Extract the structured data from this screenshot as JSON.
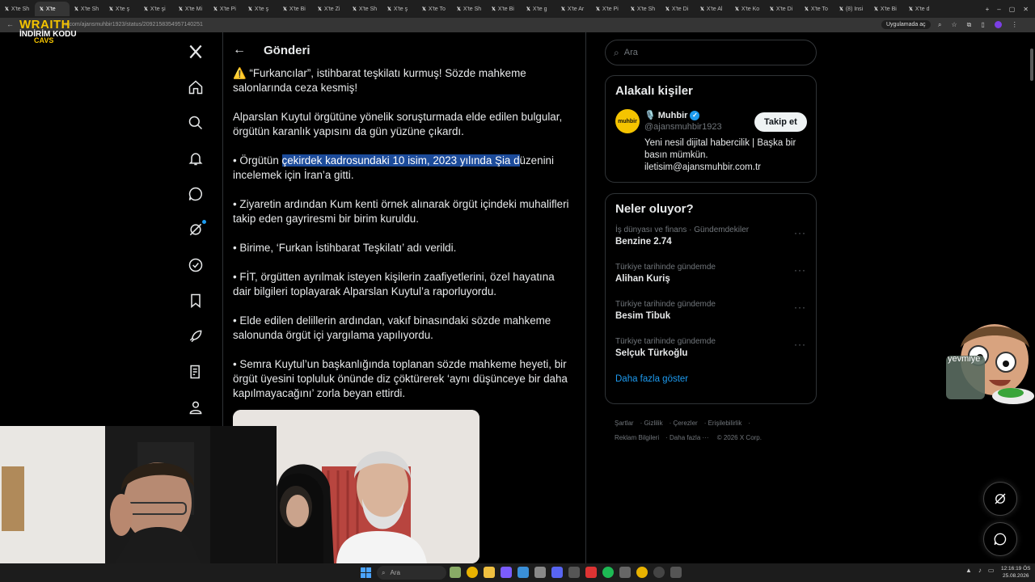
{
  "browser": {
    "tabs": [
      "X'te Sh",
      "X'te",
      "X'te Sh",
      "X'te ş",
      "X'te şi",
      "X'te Mi",
      "X'te Pi",
      "X'te ş",
      "X'te Bi",
      "X'te Zi",
      "X'te Sh",
      "X'te ş",
      "X'te To",
      "X'te Sh",
      "X'te Bi",
      "X'te g",
      "X'te Ar",
      "X'te Pi",
      "X'te Sh",
      "X'te Di",
      "X'te Al",
      "X'te Ko",
      "X'te Di",
      "X'te To",
      "(8) Insi",
      "X'te Bi",
      "X'te d"
    ],
    "active_tab": "X'te",
    "url": "x.com/ajansmuhbir1923/status/2092158354957140251",
    "app_button": "Uygulamada aç"
  },
  "stream_logo": {
    "line1": "WRAITH",
    "line2": "İNDİRİM KODU",
    "line3": "CAVS"
  },
  "nav_icons": [
    "x-logo-icon",
    "home-icon",
    "search-icon",
    "notifications-icon",
    "messages-icon",
    "grok-icon",
    "verified-icon",
    "bookmarks-icon",
    "rocket-icon",
    "premium-icon",
    "profile-icon"
  ],
  "header": {
    "title": "Gönderi"
  },
  "post": {
    "p1": "⚠️ “Furkancılar”, istihbarat teşkilatı kurmuş! Sözde mahkeme salonlarında ceza kesmiş!",
    "p2": "Alparslan Kuytul örgütüne yönelik soruşturmada elde edilen bulgular, örgütün karanlık yapısını da gün yüzüne çıkardı.",
    "p3_before": "• Örgütün ",
    "p3_highlight": "çekirdek kadrosundaki 10 isim, 2023 yılında Şia d",
    "p3_after": "üzenini incelemek için İran’a gitti.",
    "p4": "• Ziyaretin ardından Kum kenti örnek alınarak örgüt içindeki muhalifleri takip eden gayriresmi bir birim kuruldu.",
    "p5": "• Birime, ‘Furkan İstihbarat Teşkilatı’ adı verildi.",
    "p6": "• FİT, örgütten ayrılmak isteyen kişilerin zaafiyetlerini, özel hayatına dair bilgileri toplayarak Alparslan Kuytul’a raporluyordu.",
    "p7": "• Elde edilen delillerin ardından, vakıf binasındaki sözde mahkeme salonunda örgüt içi yargılama yapılıyordu.",
    "p8": "• Semra Kuytul’un başkanlığında toplanan sözde mahkeme heyeti, bir örgüt üyesini topluluk önünde diz çöktürerek ‘aynı düşünceye bir daha kapılmayacağını’ zorla beyan ettirdi."
  },
  "search": {
    "placeholder": "Ara"
  },
  "related": {
    "title": "Alakalı kişiler",
    "avatar_text": "muhbir",
    "name": "🎙️ Muhbir",
    "handle": "@ajansmuhbir1923",
    "follow_label": "Takip et",
    "bio": "Yeni nesil dijital habercilik | Başka bir basın mümkün. iletisim@ajansmuhbir.com.tr"
  },
  "trends": {
    "title": "Neler oluyor?",
    "items": [
      {
        "category": "İş dünyası ve finans · Gündemdekiler",
        "name": "Benzine 2.74"
      },
      {
        "category": "Türkiye tarihinde gündemde",
        "name": "Alihan Kuriş"
      },
      {
        "category": "Türkiye tarihinde gündemde",
        "name": "Besim Tibuk"
      },
      {
        "category": "Türkiye tarihinde gündemde",
        "name": "Selçuk Türkoğlu"
      }
    ],
    "show_more": "Daha fazla göster"
  },
  "footer": {
    "links": [
      "Şartlar",
      "Gizlilik",
      "Çerezler",
      "Erişilebilirlik",
      "Reklam Bilgileri",
      "Daha fazla ···"
    ],
    "copyright": "© 2026 X Corp."
  },
  "sticker": {
    "text": "yevmiye"
  },
  "taskbar": {
    "search_placeholder": "Ara",
    "time": "12:16:19 ÖS",
    "date": "25.08.2026"
  },
  "colors": {
    "accent": "#1d9bf0",
    "highlight": "#1c4b9a",
    "background": "#000000",
    "border": "#2f3336"
  }
}
